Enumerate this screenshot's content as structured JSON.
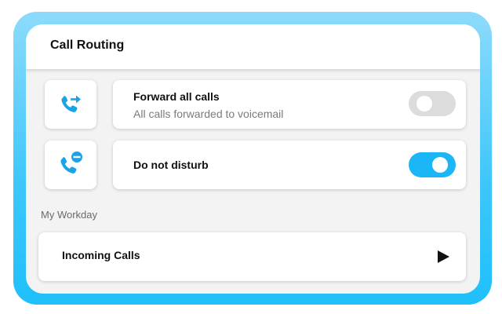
{
  "header": {
    "title": "Call Routing"
  },
  "rows": [
    {
      "icon": "call-forward-icon",
      "title": "Forward all calls",
      "subtitle": "All calls forwarded to voicemail",
      "toggle_on": false
    },
    {
      "icon": "call-dnd-icon",
      "title": "Do not disturb",
      "toggle_on": true
    }
  ],
  "section": {
    "label": "My Workday"
  },
  "incoming": {
    "label": "Incoming Calls",
    "icon": "play-arrow-icon"
  },
  "colors": {
    "accent": "#1ab6f5",
    "frame": "#3cc6fb",
    "toggle_off": "#dcdcdc"
  }
}
